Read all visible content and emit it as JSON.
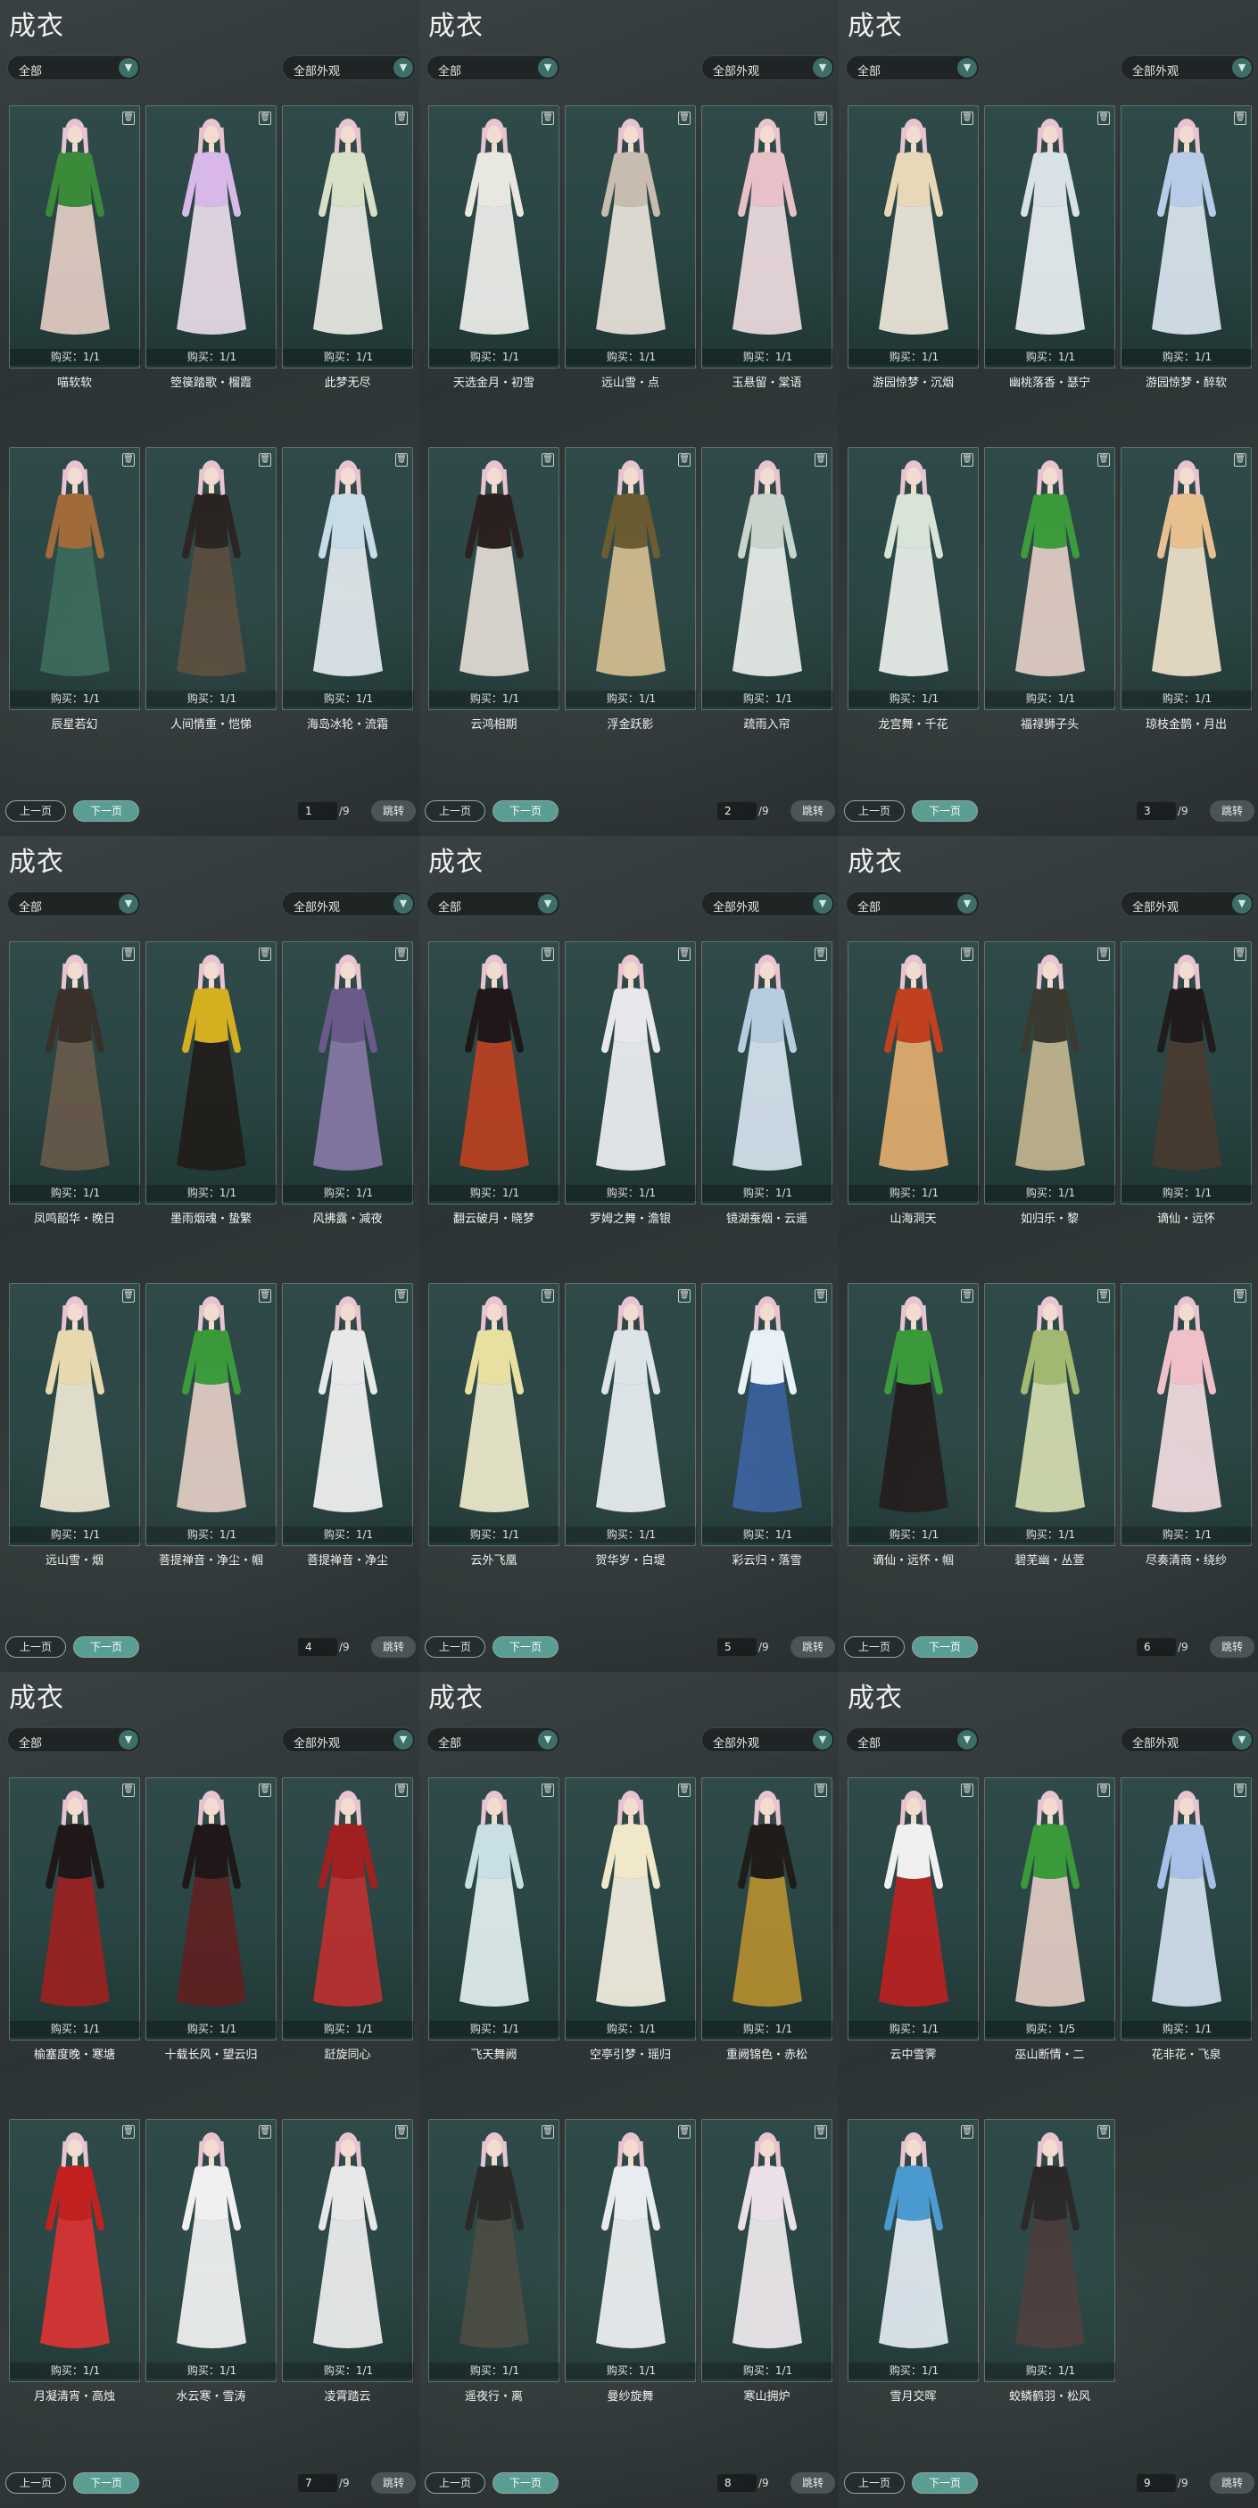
{
  "panel_title": "成衣",
  "filter1_label": "全部",
  "filter2_label": "全部外观",
  "buttons": {
    "prev": "上一页",
    "next": "下一页",
    "jump": "跳转"
  },
  "colors": {
    "accent": "#5a9d93",
    "card_bg": "#2f4a48",
    "dropdown_bg": "#1f2425"
  },
  "icons": {
    "trash": "trash-icon",
    "dropdown": "chevron-down-icon"
  },
  "panels": [
    {
      "page": "1",
      "total": "/9",
      "items": [
        {
          "name": "喵软软",
          "buy": "购买：1/1"
        },
        {
          "name": "箜篌踏歌・榴霞",
          "buy": "购买：1/1"
        },
        {
          "name": "此梦无尽",
          "buy": "购买：1/1"
        },
        {
          "name": "辰星若幻",
          "buy": "购买：1/1"
        },
        {
          "name": "人间情重・恺悌",
          "buy": "购买：1/1"
        },
        {
          "name": "海岛冰轮・流霜",
          "buy": "购买：1/1"
        }
      ]
    },
    {
      "page": "2",
      "total": "/9",
      "items": [
        {
          "name": "天选金月・初雪",
          "buy": "购买：1/1"
        },
        {
          "name": "远山雪・点",
          "buy": "购买：1/1"
        },
        {
          "name": "玉悬留・棠语",
          "buy": "购买：1/1"
        },
        {
          "name": "云鸿相期",
          "buy": "购买：1/1"
        },
        {
          "name": "浮金跃影",
          "buy": "购买：1/1"
        },
        {
          "name": "疏雨入帘",
          "buy": "购买：1/1"
        }
      ]
    },
    {
      "page": "3",
      "total": "/9",
      "items": [
        {
          "name": "游园惊梦・沉烟",
          "buy": "购买：1/1"
        },
        {
          "name": "幽桃落香・瑟宁",
          "buy": "购买：1/1"
        },
        {
          "name": "游园惊梦・醉软",
          "buy": "购买：1/1"
        },
        {
          "name": "龙宫舞・千花",
          "buy": "购买：1/1"
        },
        {
          "name": "福禄狮子头",
          "buy": "购买：1/1"
        },
        {
          "name": "琼枝金鹊・月出",
          "buy": "购买：1/1"
        }
      ]
    },
    {
      "page": "4",
      "total": "/9",
      "items": [
        {
          "name": "凤鸣韶华・晚日",
          "buy": "购买：1/1"
        },
        {
          "name": "墨雨烟魂・蛰繁",
          "buy": "购买：1/1"
        },
        {
          "name": "风拂露・减夜",
          "buy": "购买：1/1"
        },
        {
          "name": "远山雪・烟",
          "buy": "购买：1/1"
        },
        {
          "name": "菩提禅音・净尘・帼",
          "buy": "购买：1/1"
        },
        {
          "name": "菩提禅音・净尘",
          "buy": "购买：1/1"
        }
      ]
    },
    {
      "page": "5",
      "total": "/9",
      "items": [
        {
          "name": "翻云破月・晓梦",
          "buy": "购买：1/1"
        },
        {
          "name": "罗姆之舞・澹银",
          "buy": "购买：1/1"
        },
        {
          "name": "镜湖蚕烟・云遥",
          "buy": "购买：1/1"
        },
        {
          "name": "云外飞凰",
          "buy": "购买：1/1"
        },
        {
          "name": "贺华岁・白堤",
          "buy": "购买：1/1"
        },
        {
          "name": "彩云归・落雪",
          "buy": "购买：1/1"
        }
      ]
    },
    {
      "page": "6",
      "total": "/9",
      "items": [
        {
          "name": "山海洞天",
          "buy": "购买：1/1"
        },
        {
          "name": "如归乐・黎",
          "buy": "购买：1/1"
        },
        {
          "name": "谪仙・远怀",
          "buy": "购买：1/1"
        },
        {
          "name": "谪仙・远怀・帼",
          "buy": "购买：1/1"
        },
        {
          "name": "碧芜幽・丛萱",
          "buy": "购买：1/1"
        },
        {
          "name": "尽奏清商・绕纱",
          "buy": "购买：1/1"
        }
      ]
    },
    {
      "page": "7",
      "total": "/9",
      "items": [
        {
          "name": "榆塞度晚・寒塘",
          "buy": "购买：1/1"
        },
        {
          "name": "十载长风・望云归",
          "buy": "购买：1/1"
        },
        {
          "name": "跹旋同心",
          "buy": "购买：1/1"
        },
        {
          "name": "月凝清宵・高烛",
          "buy": "购买：1/1"
        },
        {
          "name": "水云寒・雪涛",
          "buy": "购买：1/1"
        },
        {
          "name": "凌霄踏云",
          "buy": "购买：1/1"
        }
      ]
    },
    {
      "page": "8",
      "total": "/9",
      "items": [
        {
          "name": "飞天舞阙",
          "buy": "购买：1/1"
        },
        {
          "name": "空亭引梦・瑶归",
          "buy": "购买：1/1"
        },
        {
          "name": "重阙锦色・赤松",
          "buy": "购买：1/1"
        },
        {
          "name": "遥夜行・离",
          "buy": "购买：1/1"
        },
        {
          "name": "曼纱旋舞",
          "buy": "购买：1/1"
        },
        {
          "name": "寒山拥炉",
          "buy": "购买：1/1"
        }
      ]
    },
    {
      "page": "9",
      "total": "/9",
      "items": [
        {
          "name": "云中雪霁",
          "buy": "购买：1/1"
        },
        {
          "name": "巫山断情・二",
          "buy": "购买：1/5"
        },
        {
          "name": "花非花・飞泉",
          "buy": "购买：1/1"
        },
        {
          "name": "雪月交晖",
          "buy": "购买：1/1"
        },
        {
          "name": "蛟鳞鹤羽・松风",
          "buy": "购买：1/1"
        }
      ]
    }
  ]
}
